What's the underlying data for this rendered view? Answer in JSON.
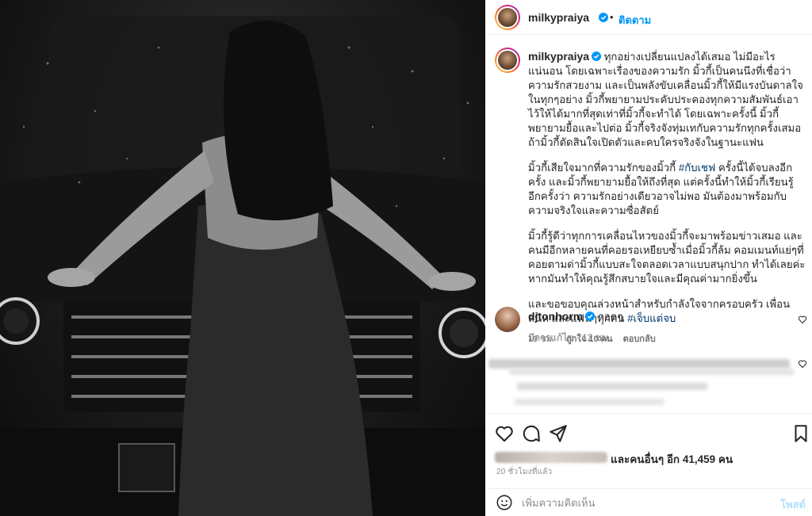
{
  "photo": {
    "alt": ""
  },
  "header": {
    "username": "milkypraiya",
    "follow_label": "ติดตาม",
    "dot": "•"
  },
  "caption": {
    "username": "milkypraiya",
    "p1": "ทุกอย่างเปลี่ยนแปลงได้เสมอ ไม่มีอะไรแน่นอน โดยเฉพาะเรื่องของความรัก มิ้วกี้เป็นคนนึงที่เชื่อว่าความรักสวยงาม และเป็นพลังขับเคลื่อนมิ้วกี้ให้มีแรงบันดาลใจในทุกๆอย่าง มิ้วกี้พยายามประคับประคองทุกความสัมพันธ์เอาไว้ให้ได้มากที่สุดเท่าที่มิ้วกี้จะทำได้ โดยเฉพาะครั้งนี้ มิ้วกี้พยายามยื้อและไปต่อ มิ้วกี้จริงจังทุ่มเทกับความรักทุกครั้งเสมอ ถ้ามิ้วกี้ตัดสินใจเปิดตัวและคบใครจริงจังในฐานะแฟน",
    "p2a": "มิ้วกี้เสียใจมากที่ความรักของมิ้วกี้ ",
    "p2_tag": "#กับเชฟ",
    "p2b": " ครั้งนี้ได้จบลงอีกครั้ง และมิ้วกี้พยายามยื้อให้ถึงที่สุด แต่ครั้งนี้ทำให้มิ้วกี้เรียนรู้อีกครั้งว่า ความรักอย่างเดียวอาจไม่พอ มันต้องมาพร้อมกับความจริงใจและความซื่อสัตย์",
    "p3": "มิ้วกี้รู้ดีว่าทุกการเคลื่อนไหวของมิ้วกี้จะมาพร้อมข่าวเสมอ และคนมีอีกหลายคนที่คอยรอเหยียบซ้ำเมื่อมิ้วกี้ล้ม คอมเมนท์แย่ๆที่คอยตามด่ามิ้วกี้แบบสะใจตลอดเวลาแบบสนุกปาก ทำได้เลยค่ะ หากมันทำให้คุณรู้สึกสบายใจและมีคุณค่ามากยิ่งขึ้น",
    "p4a": "และขอขอบคุณล่วงหน้าสำหรับกำลังใจจากครอบครัว เพื่อนสนิท และแฟนๆทุกคน ",
    "p4_tag": "#เจ็บแต่จบ",
    "meta": "มีการแก้ไข · 12 ชม."
  },
  "comment1": {
    "username": "djtonhorm",
    "text": "กอดๆ",
    "time": "19 ชม.",
    "likes": "ถูกใจ 10 คน",
    "reply": "ตอบกลับ"
  },
  "likes_line": "และคนอื่นๆ อีก 41,459 คน",
  "time_ago": "20 ชั่วโมงที่แล้ว",
  "add_comment": {
    "placeholder": "เพิ่มความคิดเห็น",
    "post_label": "โพสต์"
  },
  "colors": {
    "accent": "#0095f6",
    "hashtag": "#00376b",
    "verified": "#0095f6"
  },
  "icons": {
    "like": "heart-icon",
    "comment": "comment-icon",
    "share": "paper-plane-icon",
    "save": "bookmark-icon",
    "emoji": "smiley-icon",
    "more": "more-dots-icon"
  }
}
